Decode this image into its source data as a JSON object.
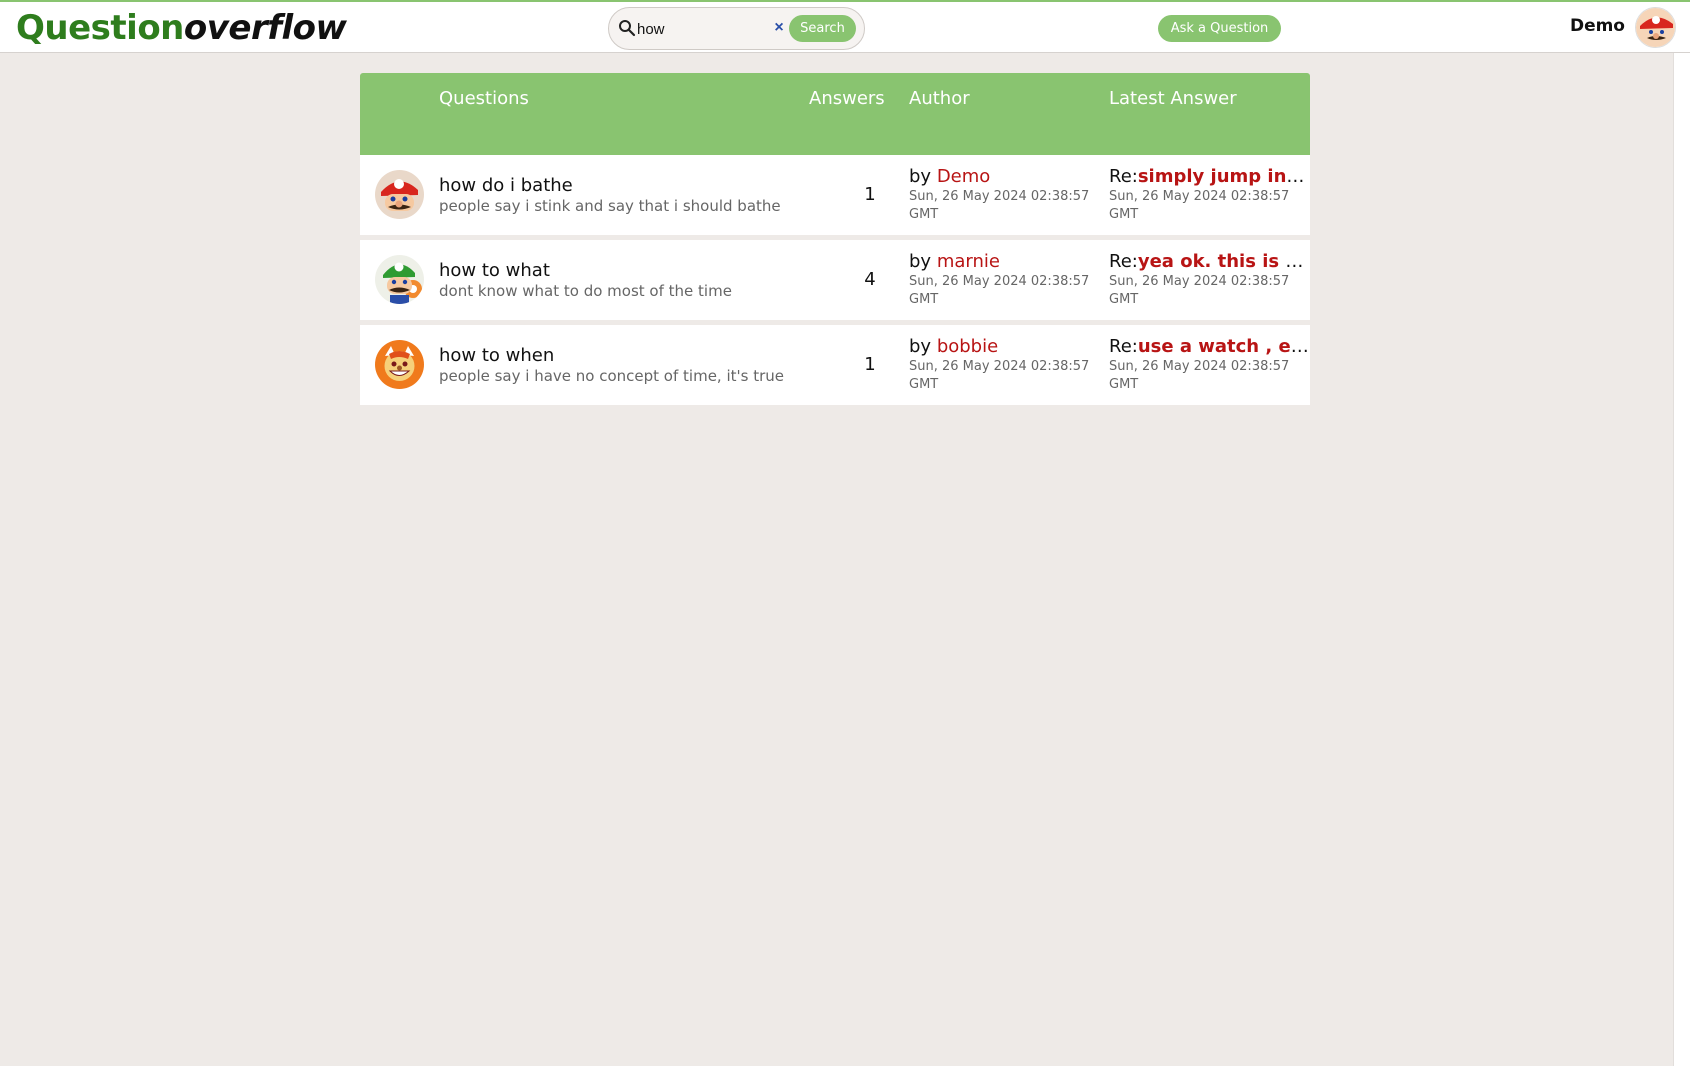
{
  "header": {
    "logo_part1": "Question",
    "logo_part2": "overflow",
    "search": {
      "value": "how",
      "clear_glyph": "×",
      "button_label": "Search"
    },
    "ask_label": "Ask a Question",
    "user_name": "Demo"
  },
  "table": {
    "headers": {
      "questions": "Questions",
      "answers": "Answers",
      "author": "Author",
      "latest": "Latest Answer"
    },
    "rows": [
      {
        "avatar": "mario-avatar",
        "title": "how do i bathe",
        "body": "people say i stink and say that i should bathe",
        "answers": "1",
        "by": "by",
        "author": "Demo",
        "author_date": "Sun, 26 May 2024 02:38:57 GMT",
        "re": "Re:",
        "latest": "simply jump insi...",
        "latest_date": "Sun, 26 May 2024 02:38:57 GMT"
      },
      {
        "avatar": "luigi-avatar",
        "title": "how to what",
        "body": "dont know what to do most of the time",
        "answers": "4",
        "by": "by",
        "author": "marnie",
        "author_date": "Sun, 26 May 2024 02:38:57 GMT",
        "re": "Re:",
        "latest": "yea ok. this is rig...",
        "latest_date": "Sun, 26 May 2024 02:38:57 GMT"
      },
      {
        "avatar": "bowser-avatar",
        "title": "how to when",
        "body": "people say i have no concept of time, it's true",
        "answers": "1",
        "by": "by",
        "author": "bobbie",
        "author_date": "Sun, 26 May 2024 02:38:57 GMT",
        "re": "Re:",
        "latest": "use a watch , eas...",
        "latest_date": "Sun, 26 May 2024 02:38:57 GMT"
      }
    ]
  },
  "colors": {
    "accent": "#89c470",
    "logo_green": "#2e7d1d",
    "link_red": "#b81414",
    "background": "#eeeae7"
  }
}
